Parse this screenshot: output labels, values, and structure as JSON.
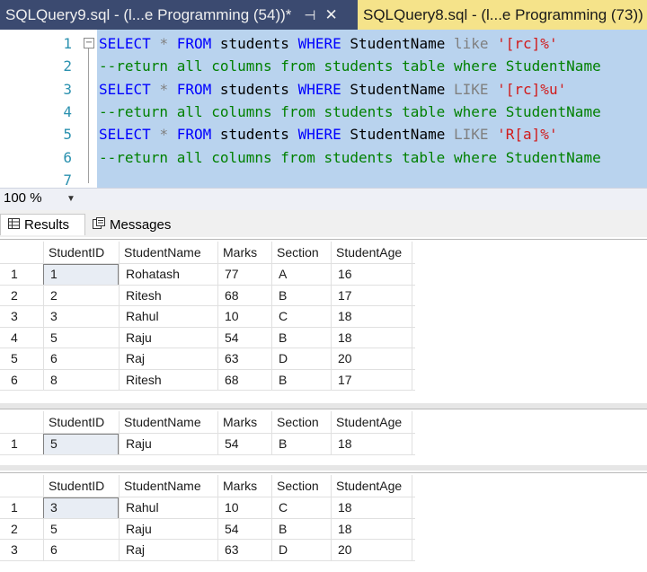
{
  "tabs": [
    {
      "title": "SQLQuery9.sql - (l...e Programming (54))*",
      "pin": "⊣",
      "close": "✕"
    },
    {
      "title": "SQLQuery8.sql - (l...e Programming (73))"
    }
  ],
  "editor": {
    "lines": [
      {
        "num": "1",
        "parts": [
          [
            "kw",
            "SELECT "
          ],
          [
            "gray",
            "* "
          ],
          [
            "kw",
            "FROM "
          ],
          [
            "",
            "students "
          ],
          [
            "kw",
            "WHERE "
          ],
          [
            "",
            "StudentName "
          ],
          [
            "gray",
            "like "
          ],
          [
            "str",
            "'[rc]%'"
          ]
        ]
      },
      {
        "num": "2",
        "parts": [
          [
            "cm",
            "--return all columns from students table where StudentName"
          ]
        ]
      },
      {
        "num": "3",
        "parts": [
          [
            "kw",
            "SELECT "
          ],
          [
            "gray",
            "* "
          ],
          [
            "kw",
            "FROM "
          ],
          [
            "",
            "students "
          ],
          [
            "kw",
            "WHERE "
          ],
          [
            "",
            "StudentName "
          ],
          [
            "gray",
            "LIKE "
          ],
          [
            "str",
            "'[rc]%u'"
          ]
        ]
      },
      {
        "num": "4",
        "parts": [
          [
            "cm",
            "--return all columns from students table where StudentName"
          ]
        ]
      },
      {
        "num": "5",
        "parts": [
          [
            "kw",
            "SELECT "
          ],
          [
            "gray",
            "* "
          ],
          [
            "kw",
            "FROM "
          ],
          [
            "",
            "students "
          ],
          [
            "kw",
            "WHERE "
          ],
          [
            "",
            "StudentName "
          ],
          [
            "gray",
            "LIKE "
          ],
          [
            "str",
            "'R[a]%'"
          ]
        ]
      },
      {
        "num": "6",
        "parts": [
          [
            "cm",
            "--return all columns from students table where StudentName"
          ]
        ]
      },
      {
        "num": "7",
        "parts": []
      }
    ]
  },
  "zoom": "100 %",
  "result_tabs": {
    "results": "Results",
    "messages": "Messages"
  },
  "columns": [
    "StudentID",
    "StudentName",
    "Marks",
    "Section",
    "StudentAge"
  ],
  "grids": [
    {
      "rows": [
        [
          "1",
          "1",
          "Rohatash",
          "77",
          "A",
          "16"
        ],
        [
          "2",
          "2",
          "Ritesh",
          "68",
          "B",
          "17"
        ],
        [
          "3",
          "3",
          "Rahul",
          "10",
          "C",
          "18"
        ],
        [
          "4",
          "5",
          "Raju",
          "54",
          "B",
          "18"
        ],
        [
          "5",
          "6",
          "Raj",
          "63",
          "D",
          "20"
        ],
        [
          "6",
          "8",
          "Ritesh",
          "68",
          "B",
          "17"
        ]
      ]
    },
    {
      "rows": [
        [
          "1",
          "5",
          "Raju",
          "54",
          "B",
          "18"
        ]
      ]
    },
    {
      "rows": [
        [
          "1",
          "3",
          "Rahul",
          "10",
          "C",
          "18"
        ],
        [
          "2",
          "5",
          "Raju",
          "54",
          "B",
          "18"
        ],
        [
          "3",
          "6",
          "Raj",
          "63",
          "D",
          "20"
        ]
      ]
    }
  ]
}
